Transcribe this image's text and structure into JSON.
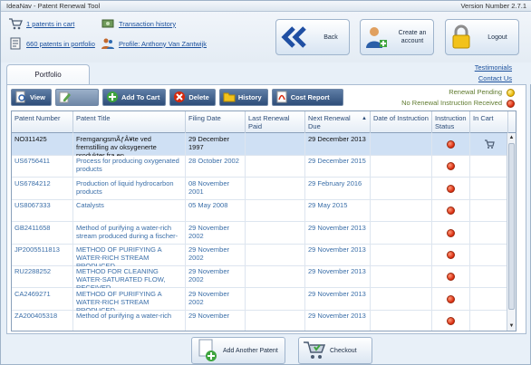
{
  "window": {
    "title": "IdeaNav - Patent Renewal Tool",
    "version": "Version Number 2.7.1"
  },
  "header": {
    "cart_link": "1 patents in cart",
    "portfolio_link": "660 patents in portfolio",
    "transaction_link": "Transaction history",
    "profile_link": "Profile: Anthony Van Zantwijk",
    "back_label": "Back",
    "create_account_label": "Create an account",
    "logout_label": "Logout"
  },
  "tabs": {
    "portfolio": "Portfolio"
  },
  "links": {
    "testimonials": "Testimonials",
    "contact": "Contact Us"
  },
  "toolbar": {
    "view": "View",
    "edit": "",
    "add_to_cart": "Add To Cart",
    "delete": "Delete",
    "history": "History",
    "cost_report": "Cost Report"
  },
  "legend": {
    "pending": "Renewal Pending",
    "no_instruction": "No Renewal Instruction Received"
  },
  "colors": {
    "pending": "#e8b400",
    "no_instruction": "#d8280b",
    "selected_row": "#cfe0f4",
    "link": "#1a4f9c"
  },
  "grid": {
    "columns": [
      "Patent Number",
      "Patent Title",
      "Filing Date",
      "Last Renewal Paid",
      "Next Renewal Due",
      "Date of Instruction",
      "Instruction Status",
      "In Cart"
    ],
    "sort_indicator": "▲",
    "rows": [
      {
        "number": "NO311425",
        "title": "FremgangsmÃƒÂ¥te ved fremstilling av oksygenerte produkter fra en",
        "filing": "29 December 1997",
        "last": "",
        "next": "29 December 2013",
        "instr_date": "",
        "status": "red",
        "in_cart": true
      },
      {
        "number": "US6756411",
        "title": "Process for producing oxygenated products",
        "filing": "28 October 2002",
        "last": "",
        "next": "29 December 2015",
        "instr_date": "",
        "status": "red",
        "in_cart": false
      },
      {
        "number": "US6784212",
        "title": "Production of liquid hydrocarbon products",
        "filing": "08 November 2001",
        "last": "",
        "next": "29 February 2016",
        "instr_date": "",
        "status": "red",
        "in_cart": false
      },
      {
        "number": "US8067333",
        "title": "Catalysts",
        "filing": "05 May 2008",
        "last": "",
        "next": "29 May 2015",
        "instr_date": "",
        "status": "red",
        "in_cart": false
      },
      {
        "number": "GB2411658",
        "title": "Method of purifying a water-rich stream produced during a fischer-",
        "filing": "29 November 2002",
        "last": "",
        "next": "29 November 2013",
        "instr_date": "",
        "status": "red",
        "in_cart": false
      },
      {
        "number": "JP2005511813",
        "title": "METHOD OF PURIFYING A WATER-RICH STREAM PRODUCED",
        "filing": "29 November 2002",
        "last": "",
        "next": "29 November 2013",
        "instr_date": "",
        "status": "red",
        "in_cart": false
      },
      {
        "number": "RU2288252",
        "title": "METHOD FOR CLEANING WATER-SATURATED FLOW, RECEIVED",
        "filing": "29 November 2002",
        "last": "",
        "next": "29 November 2013",
        "instr_date": "",
        "status": "red",
        "in_cart": false
      },
      {
        "number": "CA2469271",
        "title": "METHOD OF PURIFYING A WATER-RICH STREAM PRODUCED",
        "filing": "29 November 2002",
        "last": "",
        "next": "29 November 2013",
        "instr_date": "",
        "status": "red",
        "in_cart": false
      },
      {
        "number": "ZA200405318",
        "title": "Method of purifying a water-rich",
        "filing": "29 November",
        "last": "",
        "next": "29 November 2013",
        "instr_date": "",
        "status": "red",
        "in_cart": false
      }
    ]
  },
  "bottom": {
    "add_patent": "Add Another Patent",
    "checkout": "Checkout"
  }
}
